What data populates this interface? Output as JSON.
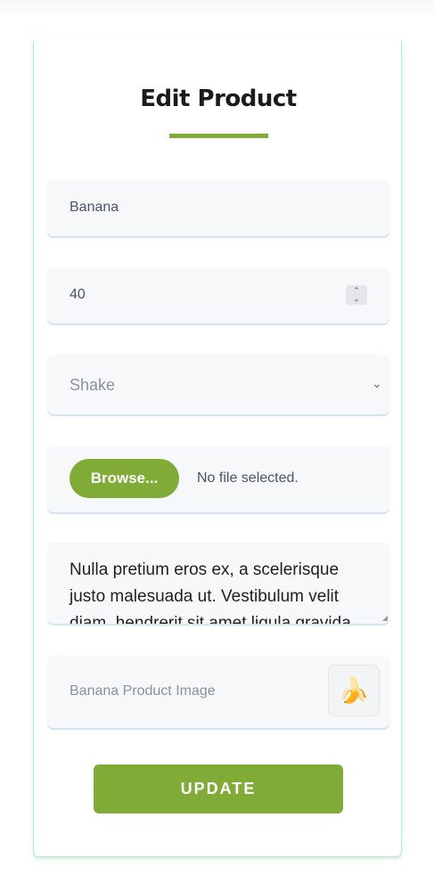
{
  "page": {
    "title": "Edit Product"
  },
  "form": {
    "name_value": "Banana",
    "price_value": "40",
    "category_value": "Shake",
    "file": {
      "browse_label": "Browse...",
      "status": "No file selected."
    },
    "description_value": "Nulla pretium eros ex, a scelerisque justo malesuada ut. Vestibulum velit diam, hendrerit sit amet ligula gravida,",
    "image_label": "Banana Product Image",
    "image_emoji": "🍌",
    "update_label": "UPDATE"
  },
  "colors": {
    "accent": "#7fab36",
    "card_border": "#b7efc9",
    "field_bg": "#f7f8fa"
  },
  "icons": {
    "stepper": "stepper-arrows-icon",
    "select": "chevron-down-icon",
    "image": "banana-icon"
  }
}
